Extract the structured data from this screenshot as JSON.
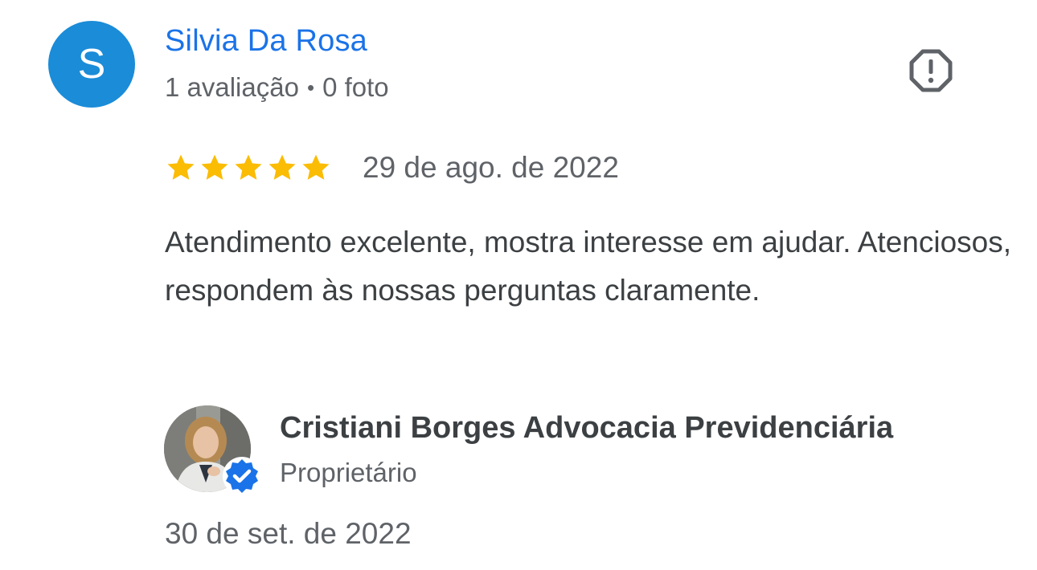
{
  "review": {
    "reviewer": {
      "initial": "S",
      "name": "Silvia Da Rosa",
      "reviews_count": "1 avaliação",
      "separator": "•",
      "photos_count": "0 foto",
      "avatar_color": "#1a8cd8"
    },
    "rating": 5,
    "max_rating": 5,
    "star_color": "#fbbc04",
    "date": "29 de ago. de 2022",
    "text": "Atendimento excelente, mostra interesse em ajudar. Atenciosos, respondem às nossas perguntas claramente.",
    "report_icon": "report-flag-icon"
  },
  "owner_response": {
    "name": "Cristiani Borges Advocacia Previdenciária",
    "role": "Proprietário",
    "date": "30 de set. de 2022",
    "verified_badge_color": "#1a73e8"
  },
  "colors": {
    "link": "#1a73e8",
    "primary_text": "#3c4043",
    "secondary_text": "#5f6368"
  }
}
